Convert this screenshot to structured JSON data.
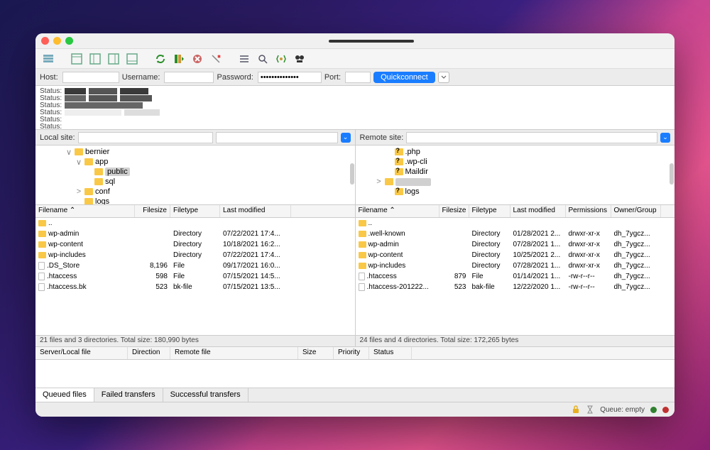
{
  "quickconnect": {
    "host_label": "Host:",
    "username_label": "Username:",
    "password_label": "Password:",
    "password_value": "••••••••••••••",
    "port_label": "Port:",
    "button": "Quickconnect"
  },
  "log": {
    "label": "Status:"
  },
  "local": {
    "label": "Local site:",
    "tree": [
      {
        "indent": 3,
        "twisty": "∨",
        "name": "bernier"
      },
      {
        "indent": 4,
        "twisty": "∨",
        "name": "app"
      },
      {
        "indent": 5,
        "twisty": "",
        "name": "public",
        "selected": true
      },
      {
        "indent": 5,
        "twisty": "",
        "name": "sql"
      },
      {
        "indent": 4,
        "twisty": ">",
        "name": "conf"
      },
      {
        "indent": 4,
        "twisty": "",
        "name": "logs"
      }
    ],
    "columns": {
      "name": "Filename ⌃",
      "size": "Filesize",
      "type": "Filetype",
      "modified": "Last modified"
    },
    "files": [
      {
        "icon": "folder",
        "name": "..",
        "size": "",
        "type": "",
        "modified": ""
      },
      {
        "icon": "folder",
        "name": "wp-admin",
        "size": "",
        "type": "Directory",
        "modified": "07/22/2021 17:4..."
      },
      {
        "icon": "folder",
        "name": "wp-content",
        "size": "",
        "type": "Directory",
        "modified": "10/18/2021 16:2..."
      },
      {
        "icon": "folder",
        "name": "wp-includes",
        "size": "",
        "type": "Directory",
        "modified": "07/22/2021 17:4..."
      },
      {
        "icon": "file",
        "name": ".DS_Store",
        "size": "8,196",
        "type": "File",
        "modified": "09/17/2021 16:0..."
      },
      {
        "icon": "file",
        "name": ".htaccess",
        "size": "598",
        "type": "File",
        "modified": "07/15/2021 14:5..."
      },
      {
        "icon": "file",
        "name": ".htaccess.bk",
        "size": "523",
        "type": "bk-file",
        "modified": "07/15/2021 13:5..."
      }
    ],
    "status": "21 files and 3 directories. Total size: 180,990 bytes"
  },
  "remote": {
    "label": "Remote site:",
    "tree": [
      {
        "indent": 3,
        "q": true,
        "name": ".php"
      },
      {
        "indent": 3,
        "q": true,
        "name": ".wp-cli"
      },
      {
        "indent": 3,
        "q": true,
        "name": "Maildir"
      },
      {
        "indent": 2,
        "twisty": ">",
        "name": "",
        "selected": true
      },
      {
        "indent": 3,
        "q": true,
        "name": "logs"
      }
    ],
    "columns": {
      "name": "Filename ⌃",
      "size": "Filesize",
      "type": "Filetype",
      "modified": "Last modified",
      "perms": "Permissions",
      "owner": "Owner/Group"
    },
    "files": [
      {
        "icon": "folder",
        "name": "..",
        "size": "",
        "type": "",
        "modified": "",
        "perms": "",
        "owner": ""
      },
      {
        "icon": "folder",
        "name": ".well-known",
        "size": "",
        "type": "Directory",
        "modified": "01/28/2021 2...",
        "perms": "drwxr-xr-x",
        "owner": "dh_7ygcz..."
      },
      {
        "icon": "folder",
        "name": "wp-admin",
        "size": "",
        "type": "Directory",
        "modified": "07/28/2021 1...",
        "perms": "drwxr-xr-x",
        "owner": "dh_7ygcz..."
      },
      {
        "icon": "folder",
        "name": "wp-content",
        "size": "",
        "type": "Directory",
        "modified": "10/25/2021 2...",
        "perms": "drwxr-xr-x",
        "owner": "dh_7ygcz..."
      },
      {
        "icon": "folder",
        "name": "wp-includes",
        "size": "",
        "type": "Directory",
        "modified": "07/28/2021 1...",
        "perms": "drwxr-xr-x",
        "owner": "dh_7ygcz..."
      },
      {
        "icon": "file",
        "name": ".htaccess",
        "size": "879",
        "type": "File",
        "modified": "01/14/2021 1...",
        "perms": "-rw-r--r--",
        "owner": "dh_7ygcz..."
      },
      {
        "icon": "file",
        "name": ".htaccess-201222...",
        "size": "523",
        "type": "bak-file",
        "modified": "12/22/2020 1...",
        "perms": "-rw-r--r--",
        "owner": "dh_7ygcz..."
      }
    ],
    "status": "24 files and 4 directories. Total size: 172,265 bytes"
  },
  "queue": {
    "columns": {
      "server": "Server/Local file",
      "direction": "Direction",
      "remote": "Remote file",
      "size": "Size",
      "priority": "Priority",
      "status": "Status"
    }
  },
  "tabs": {
    "queued": "Queued files",
    "failed": "Failed transfers",
    "success": "Successful transfers"
  },
  "statusbar": {
    "queue": "Queue: empty"
  }
}
